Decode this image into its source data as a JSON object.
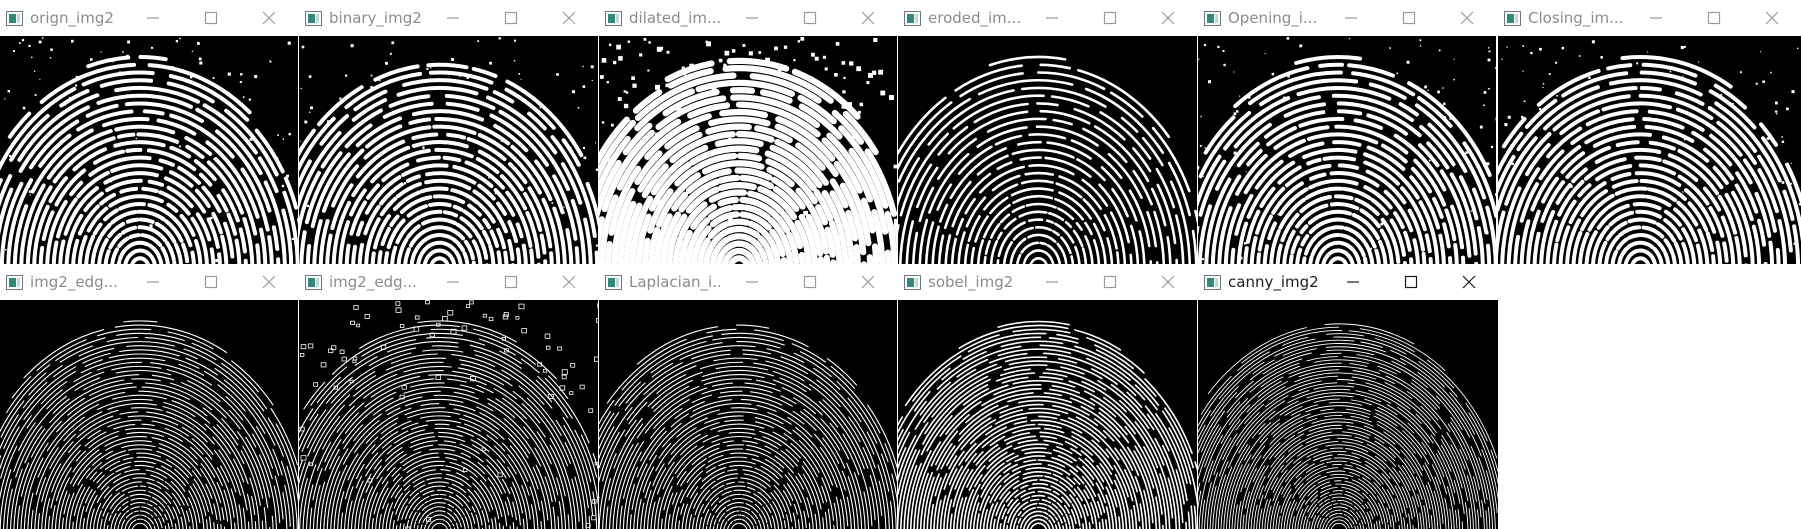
{
  "windows": [
    {
      "title": "orign_img2",
      "state": "inactive",
      "style": "ridges",
      "image_icon": "fingerprint-image"
    },
    {
      "title": "binary_img2",
      "state": "inactive",
      "style": "ridges",
      "image_icon": "fingerprint-image"
    },
    {
      "title": "dilated_im...",
      "state": "inactive",
      "style": "dilated",
      "image_icon": "fingerprint-image"
    },
    {
      "title": "eroded_im...",
      "state": "inactive",
      "style": "eroded",
      "image_icon": "fingerprint-image"
    },
    {
      "title": "Opening_i...",
      "state": "inactive",
      "style": "ridges",
      "image_icon": "fingerprint-image"
    },
    {
      "title": "Closing_im...",
      "state": "inactive",
      "style": "ridges",
      "image_icon": "fingerprint-image"
    },
    {
      "title": "img2_edg...",
      "state": "inactive",
      "style": "edges",
      "image_icon": "fingerprint-edges"
    },
    {
      "title": "img2_edg...",
      "state": "inactive",
      "style": "edges-noisy",
      "image_icon": "fingerprint-edges"
    },
    {
      "title": "Laplacian_i...",
      "state": "inactive",
      "style": "edges",
      "image_icon": "fingerprint-edges"
    },
    {
      "title": "sobel_img2",
      "state": "inactive",
      "style": "sobel",
      "image_icon": "fingerprint-edges"
    },
    {
      "title": "canny_img2",
      "state": "active",
      "style": "canny",
      "image_icon": "fingerprint-edges"
    }
  ],
  "controls": {
    "minimize": "minimize-icon",
    "maximize": "maximize-icon",
    "close": "close-icon"
  },
  "colors": {
    "titlebar": "#ffffff",
    "inactive_text": "#8c8c8c",
    "active_text": "#1f1f1f",
    "canvas": "#000000",
    "icon_teal": "#2e8b7a"
  }
}
